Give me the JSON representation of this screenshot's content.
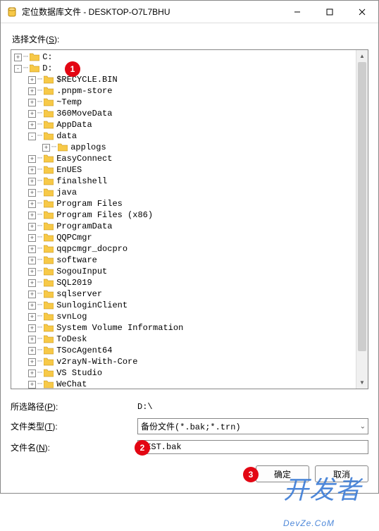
{
  "window": {
    "title": "定位数据库文件 - DESKTOP-O7L7BHU",
    "minimize_icon": "minimize",
    "maximize_icon": "maximize",
    "close_icon": "close"
  },
  "labels": {
    "select_file": "选择文件(S):",
    "selected_path": "所选路径(P):",
    "file_type": "文件类型(T):",
    "file_name": "文件名(N):"
  },
  "tree": [
    {
      "d": 0,
      "exp": "+",
      "label": "C:"
    },
    {
      "d": 0,
      "exp": "-",
      "label": "D:"
    },
    {
      "d": 1,
      "exp": "+",
      "label": "$RECYCLE.BIN"
    },
    {
      "d": 1,
      "exp": "+",
      "label": ".pnpm-store"
    },
    {
      "d": 1,
      "exp": "+",
      "label": "~Temp"
    },
    {
      "d": 1,
      "exp": "+",
      "label": "360MoveData"
    },
    {
      "d": 1,
      "exp": "+",
      "label": "AppData"
    },
    {
      "d": 1,
      "exp": "-",
      "label": "data"
    },
    {
      "d": 2,
      "exp": "+",
      "label": "applogs"
    },
    {
      "d": 1,
      "exp": "+",
      "label": "EasyConnect"
    },
    {
      "d": 1,
      "exp": "+",
      "label": "EnUES"
    },
    {
      "d": 1,
      "exp": "+",
      "label": "finalshell"
    },
    {
      "d": 1,
      "exp": "+",
      "label": "java"
    },
    {
      "d": 1,
      "exp": "+",
      "label": "Program Files"
    },
    {
      "d": 1,
      "exp": "+",
      "label": "Program Files (x86)"
    },
    {
      "d": 1,
      "exp": "+",
      "label": "ProgramData"
    },
    {
      "d": 1,
      "exp": "+",
      "label": "QQPCmgr"
    },
    {
      "d": 1,
      "exp": "+",
      "label": "qqpcmgr_docpro"
    },
    {
      "d": 1,
      "exp": "+",
      "label": "software"
    },
    {
      "d": 1,
      "exp": "+",
      "label": "SogouInput"
    },
    {
      "d": 1,
      "exp": "+",
      "label": "SQL2019"
    },
    {
      "d": 1,
      "exp": "+",
      "label": "sqlserver"
    },
    {
      "d": 1,
      "exp": "+",
      "label": "SunloginClient"
    },
    {
      "d": 1,
      "exp": "+",
      "label": "svnLog"
    },
    {
      "d": 1,
      "exp": "+",
      "label": "System Volume Information"
    },
    {
      "d": 1,
      "exp": "+",
      "label": "ToDesk"
    },
    {
      "d": 1,
      "exp": "+",
      "label": "TSocAgent64"
    },
    {
      "d": 1,
      "exp": "+",
      "label": "v2rayN-With-Core"
    },
    {
      "d": 1,
      "exp": "+",
      "label": "VS Studio"
    },
    {
      "d": 1,
      "exp": "+",
      "label": "WeChat"
    }
  ],
  "fields": {
    "path_value": "D:\\",
    "file_type_value": "备份文件(*.bak;*.trn)",
    "file_name_value": "TEST.bak"
  },
  "buttons": {
    "ok": "确定",
    "cancel": "取消"
  },
  "badges": {
    "b1": "1",
    "b2": "2",
    "b3": "3"
  },
  "watermark": {
    "cn": "开发者",
    "en": "DevZe.CoM"
  }
}
